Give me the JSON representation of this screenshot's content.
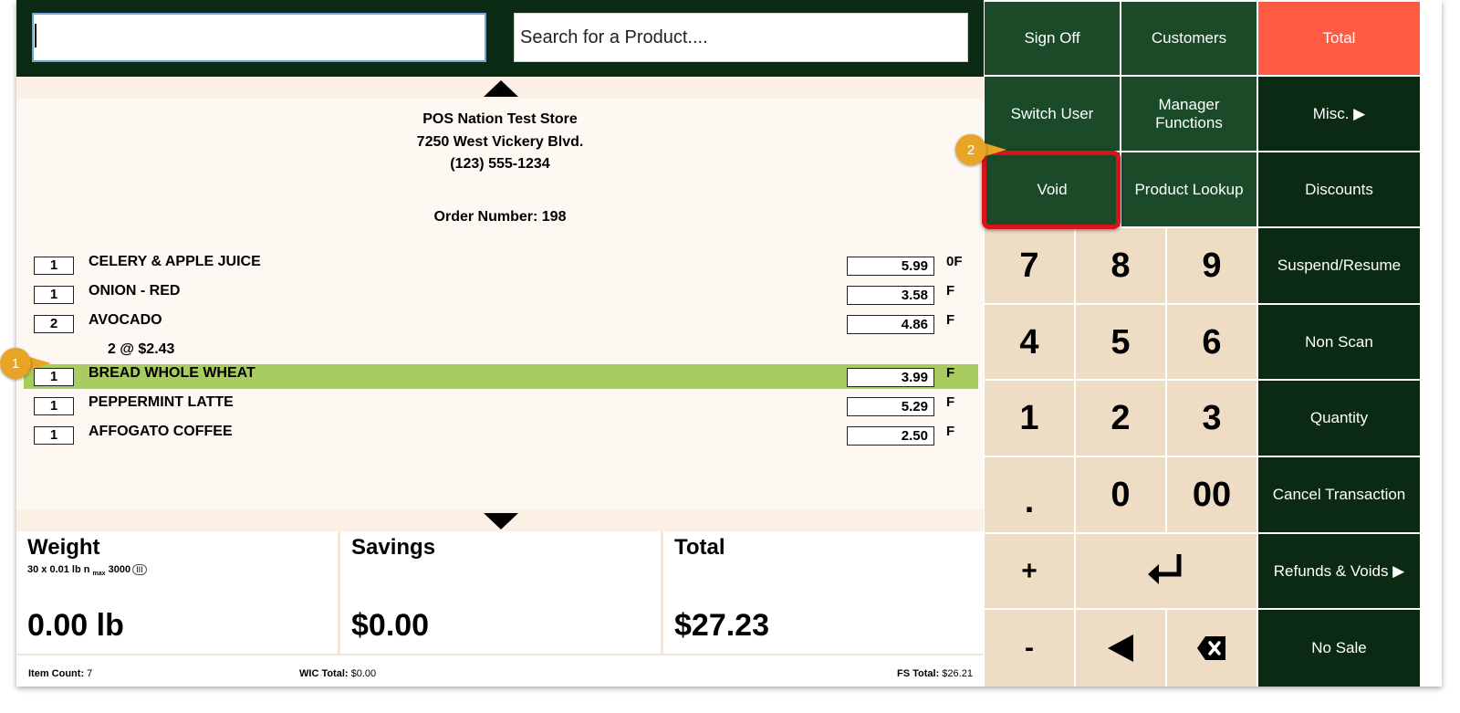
{
  "topbar": {
    "scan_value": "",
    "search_placeholder": "Search for a Product...."
  },
  "store": {
    "name": "POS Nation Test Store",
    "address": "7250 West Vickery Blvd.",
    "phone": "(123) 555-1234",
    "order_label": "Order Number: 198"
  },
  "items": [
    {
      "qty": "1",
      "name": "CELERY & APPLE JUICE",
      "price": "5.99",
      "flag": "0F"
    },
    {
      "qty": "1",
      "name": "ONION - RED",
      "price": "3.58",
      "flag": "F"
    },
    {
      "qty": "2",
      "name": "AVOCADO",
      "price": "4.86",
      "flag": "F",
      "sub": "2 @ $2.43"
    },
    {
      "qty": "1",
      "name": "BREAD WHOLE WHEAT",
      "price": "3.99",
      "flag": "F",
      "selected": true
    },
    {
      "qty": "1",
      "name": "PEPPERMINT LATTE",
      "price": "5.29",
      "flag": "F"
    },
    {
      "qty": "1",
      "name": "AFFOGATO COFFEE",
      "price": "2.50",
      "flag": "F"
    }
  ],
  "summary": {
    "weight_label": "Weight",
    "scale_spec_a": "30 x 0.01 lb n ",
    "scale_spec_max": "max",
    "scale_spec_b": " 3000",
    "scale_class": "III",
    "weight_value": "0.00 lb",
    "savings_label": "Savings",
    "savings_value": "$0.00",
    "total_label": "Total",
    "total_value": "$27.23"
  },
  "footer": {
    "item_count_label": "Item Count:",
    "item_count_value": "7",
    "wic_label": "WIC Total:",
    "wic_value": "$0.00",
    "fs_label": "FS Total:",
    "fs_value": "$26.21"
  },
  "keypad": {
    "sign_off": "Sign Off",
    "customers": "Customers",
    "total": "Total",
    "switch_user": "Switch User",
    "manager_functions": "Manager Functions",
    "misc": "Misc. ▶",
    "void": "Void",
    "product_lookup": "Product Lookup",
    "discounts": "Discounts",
    "suspend_resume": "Suspend/Resume",
    "non_scan": "Non Scan",
    "quantity": "Quantity",
    "cancel_transaction": "Cancel Transaction",
    "refunds_voids": "Refunds & Voids ▶",
    "no_sale": "No Sale",
    "digits": {
      "d7": "7",
      "d8": "8",
      "d9": "9",
      "d4": "4",
      "d5": "5",
      "d6": "6",
      "d1": "1",
      "d2": "2",
      "d3": "3",
      "dot": ".",
      "d0": "0",
      "d00": "00",
      "plus": "+",
      "minus": "-"
    }
  },
  "callouts": {
    "one": "1",
    "two": "2"
  },
  "colors": {
    "dark_green": "#0b2a14",
    "green": "#1a4a28",
    "total_red": "#ff5b42",
    "selected_row": "#a8cc60",
    "keypad_beige": "#eedcc4",
    "callout": "#e8a424",
    "highlight": "#d9131b"
  }
}
